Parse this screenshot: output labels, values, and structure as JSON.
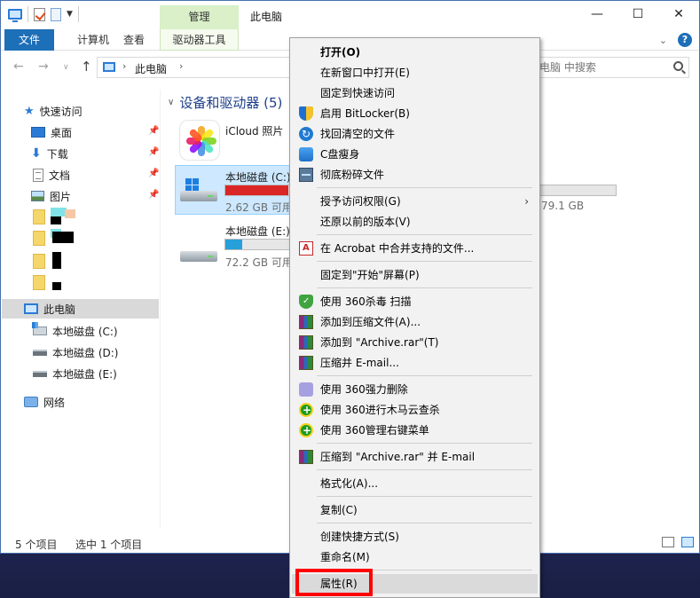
{
  "window": {
    "title": "此电脑",
    "contextual_tab": "管理",
    "controls": {
      "minimize": "—",
      "maximize": "☐",
      "close": "✕"
    }
  },
  "ribbon": {
    "tabs": [
      "文件",
      "计算机",
      "查看",
      "驱动器工具"
    ],
    "help": "?"
  },
  "address": {
    "path": "此电脑",
    "search_placeholder": "电脑 中搜索"
  },
  "nav_pane": {
    "quick_access": "快速访问",
    "pinned": [
      "桌面",
      "下载",
      "文档",
      "图片"
    ],
    "this_pc": "此电脑",
    "drives": [
      "本地磁盘 (C:)",
      "本地磁盘 (D:)",
      "本地磁盘 (E:)"
    ],
    "network": "网络"
  },
  "content": {
    "section": "设备和驱动器 (5)",
    "icloud": "iCloud 照片",
    "drive_c": {
      "name": "本地磁盘 (C:)",
      "size": "2.62 GB 可用",
      "used_fraction": 0.95
    },
    "drive_e": {
      "name": "本地磁盘 (E:)",
      "size": "72.2 GB 可用",
      "used_fraction": 0.25
    },
    "right_size": "79.1 GB"
  },
  "status": {
    "items": "5 个项目",
    "selected": "选中 1 个项目"
  },
  "context_menu": {
    "items": [
      "打开(O)",
      "在新窗口中打开(E)",
      "固定到快速访问",
      "启用 BitLocker(B)",
      "找回清空的文件",
      "C盘瘦身",
      "彻底粉碎文件",
      "授予访问权限(G)",
      "还原以前的版本(V)",
      "在 Acrobat 中合并支持的文件...",
      "固定到\"开始\"屏幕(P)",
      "使用 360杀毒 扫描",
      "添加到压缩文件(A)...",
      "添加到 \"Archive.rar\"(T)",
      "压缩并 E-mail...",
      "使用 360强力删除",
      "使用 360进行木马云查杀",
      "使用 360管理右键菜单",
      "压缩到 \"Archive.rar\" 并 E-mail",
      "格式化(A)...",
      "复制(C)",
      "创建快捷方式(S)",
      "重命名(M)",
      "属性(R)"
    ],
    "submenu_arrow": "›"
  },
  "colors": {
    "accent": "#1d6fb8",
    "drive_full": "#da2626",
    "drive_ok": "#26a0da",
    "highlight_box": "#ff0000"
  }
}
